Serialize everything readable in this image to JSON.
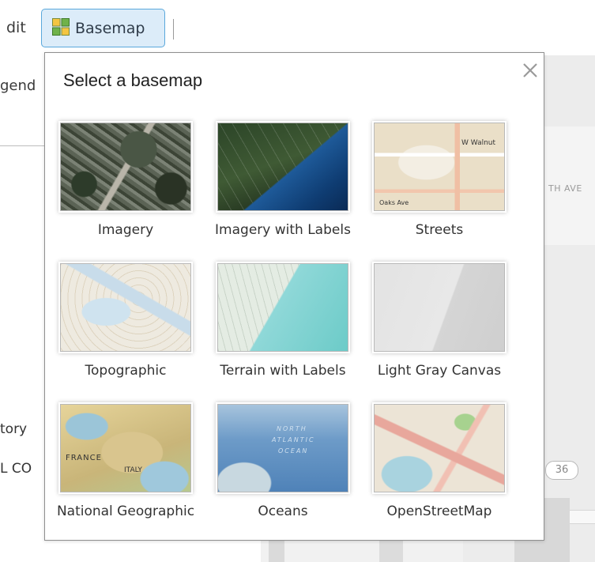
{
  "toolbar": {
    "edit_label": "dit",
    "basemap_label": "Basemap",
    "basemap_icon": "basemap-grid-icon"
  },
  "side_panel": {
    "legend_label": "gend",
    "story_label": "tory",
    "lco_label": "L CO"
  },
  "background_map": {
    "street_label": "TH AVE",
    "route_label": "36"
  },
  "basemap_gallery": {
    "title": "Select a basemap",
    "close_icon": "close-icon",
    "items": [
      {
        "id": "imagery",
        "label": "Imagery"
      },
      {
        "id": "imagery-with-labels",
        "label": "Imagery with Labels"
      },
      {
        "id": "streets",
        "label": "Streets",
        "thumb_text": [
          "W Walnut",
          "Oaks Ave"
        ]
      },
      {
        "id": "topographic",
        "label": "Topographic"
      },
      {
        "id": "terrain-with-labels",
        "label": "Terrain with Labels"
      },
      {
        "id": "light-gray-canvas",
        "label": "Light Gray Canvas"
      },
      {
        "id": "national-geographic",
        "label": "National Geographic",
        "thumb_text": [
          "FRANCE",
          "ITALY"
        ]
      },
      {
        "id": "oceans",
        "label": "Oceans",
        "thumb_text": [
          "NORTH",
          "ATLANTIC",
          "OCEAN"
        ]
      },
      {
        "id": "openstreetmap",
        "label": "OpenStreetMap"
      }
    ]
  },
  "colors": {
    "active_button_bg": "#dcecf9",
    "active_button_border": "#5aa8dc"
  }
}
